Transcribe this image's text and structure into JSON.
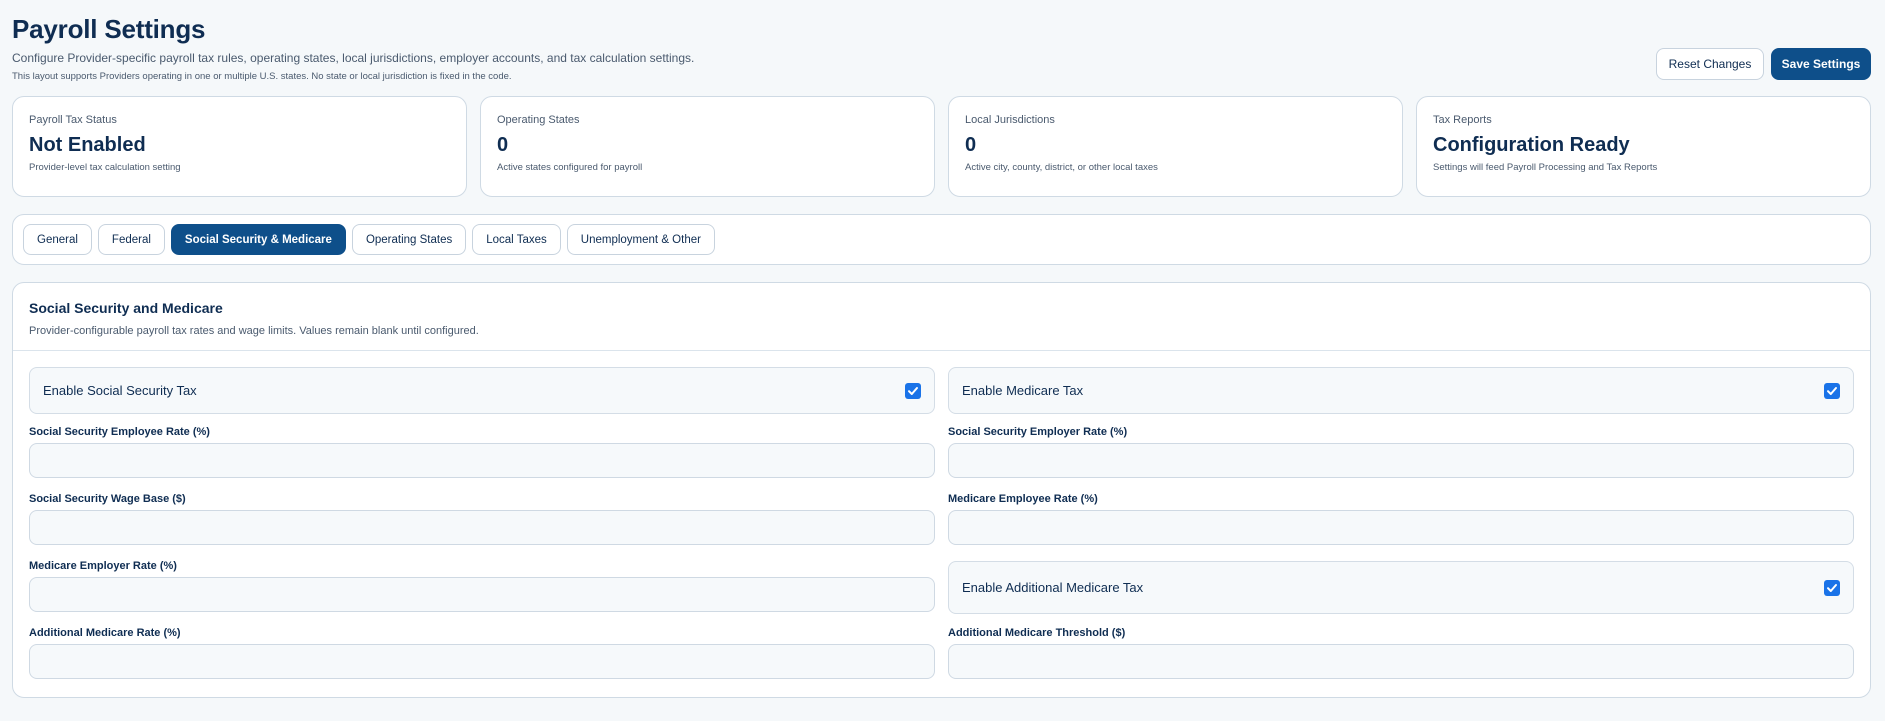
{
  "header": {
    "title": "Payroll Settings",
    "subtitle": "Configure Provider-specific payroll tax rules, operating states, local jurisdictions, employer accounts, and tax calculation settings.",
    "note": "This layout supports Providers operating in one or multiple U.S. states. No state or local jurisdiction is fixed in the code.",
    "reset_label": "Reset Changes",
    "save_label": "Save Settings"
  },
  "stats": [
    {
      "label": "Payroll Tax Status",
      "value": "Not Enabled",
      "desc": "Provider-level tax calculation setting"
    },
    {
      "label": "Operating States",
      "value": "0",
      "desc": "Active states configured for payroll"
    },
    {
      "label": "Local Jurisdictions",
      "value": "0",
      "desc": "Active city, county, district, or other local taxes"
    },
    {
      "label": "Tax Reports",
      "value": "Configuration Ready",
      "desc": "Settings will feed Payroll Processing and Tax Reports"
    }
  ],
  "tabs": [
    {
      "label": "General"
    },
    {
      "label": "Federal"
    },
    {
      "label": "Social Security & Medicare",
      "active": true
    },
    {
      "label": "Operating States"
    },
    {
      "label": "Local Taxes"
    },
    {
      "label": "Unemployment & Other"
    }
  ],
  "panel": {
    "title": "Social Security and Medicare",
    "desc": "Provider-configurable payroll tax rates and wage limits. Values remain blank until configured.",
    "toggles": {
      "social_security": {
        "label": "Enable Social Security Tax",
        "checked": true
      },
      "medicare": {
        "label": "Enable Medicare Tax",
        "checked": true
      },
      "additional_medicare": {
        "label": "Enable Additional Medicare Tax",
        "checked": true
      }
    },
    "fields": {
      "ss_employee_rate": {
        "label": "Social Security Employee Rate (%)",
        "value": ""
      },
      "ss_employer_rate": {
        "label": "Social Security Employer Rate (%)",
        "value": ""
      },
      "ss_wage_base": {
        "label": "Social Security Wage Base ($)",
        "value": ""
      },
      "medicare_employee_rate": {
        "label": "Medicare Employee Rate (%)",
        "value": ""
      },
      "medicare_employer_rate": {
        "label": "Medicare Employer Rate (%)",
        "value": ""
      },
      "additional_medicare_rate": {
        "label": "Additional Medicare Rate (%)",
        "value": ""
      },
      "additional_medicare_threshold": {
        "label": "Additional Medicare Threshold ($)",
        "value": ""
      }
    }
  },
  "colors": {
    "primary": "#0e4f8a",
    "checkbox": "#1a73e8",
    "text": "#0f2d52",
    "background": "#f5f8fa"
  }
}
